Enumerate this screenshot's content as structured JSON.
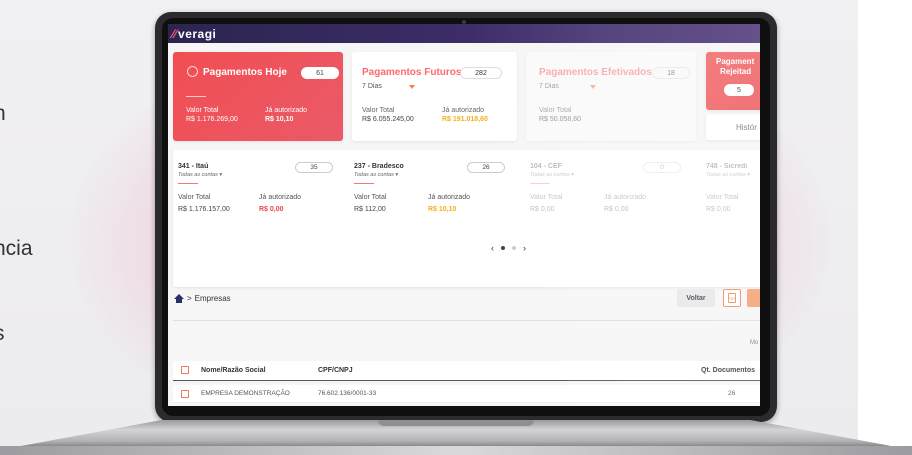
{
  "side_fragments": [
    "n",
    "ncia",
    "s"
  ],
  "app": {
    "logo_text": "veragi"
  },
  "cards": {
    "hoje": {
      "title": "Pagamentos Hoje",
      "count": "61",
      "valor_label": "Valor Total",
      "valor": "R$ 1.176.269,00",
      "aut_label": "Já autorizado",
      "aut": "R$ 10,10"
    },
    "futuros": {
      "title": "Pagamentos Futuros",
      "count": "282",
      "period": "7 Dias",
      "valor_label": "Valor Total",
      "valor": "R$ 6.055.245,00",
      "aut_label": "Já autorizado",
      "aut": "R$ 191.018,60"
    },
    "efetivados": {
      "title": "Pagamentos Efetivados",
      "count": "18",
      "period": "7 Dias",
      "valor_label": "Valor Total",
      "valor": "R$ 50.058,60"
    },
    "rejeitados": {
      "title_1": "Pagament",
      "title_2": "Rejeitad",
      "count": "5"
    },
    "historico": {
      "label": "Histór"
    }
  },
  "banks": [
    {
      "name": "341 - Itaú",
      "accounts": "Todas as contas",
      "count": "35",
      "valor_label": "Valor Total",
      "valor": "R$ 1.176.157,00",
      "aut_label": "Já autorizado",
      "aut": "R$ 0,00"
    },
    {
      "name": "237 - Bradesco",
      "accounts": "Todas as contas",
      "count": "26",
      "valor_label": "Valor Total",
      "valor": "R$ 112,00",
      "aut_label": "Já autorizado",
      "aut": "R$ 10,10"
    },
    {
      "name": "104 - CEF",
      "accounts": "Todas as contas",
      "count": "0",
      "valor_label": "Valor Total",
      "valor": "R$ 0,00",
      "aut_label": "Já autorizado",
      "aut": "R$ 0,00"
    },
    {
      "name": "748 - Sicredi",
      "accounts": "Todas as contas",
      "valor_label": "Valor Total",
      "valor": "R$ 0,00"
    }
  ],
  "pager": {
    "prev": "‹",
    "next": "›"
  },
  "breadcrumb": {
    "separator": ">",
    "current": "Empresas"
  },
  "toolbar": {
    "voltar": "Voltar",
    "pdf": "PDF"
  },
  "mo_label": "Mo",
  "table": {
    "headers": {
      "nome": "Nome/Razão Social",
      "cpf": "CPF/CNPJ",
      "qt": "Qt. Documentos"
    },
    "rows": [
      {
        "nome": "EMPRESA DEMONSTRAÇÃO",
        "cpf": "76.602.136/0001-33",
        "qt": "26"
      }
    ]
  }
}
